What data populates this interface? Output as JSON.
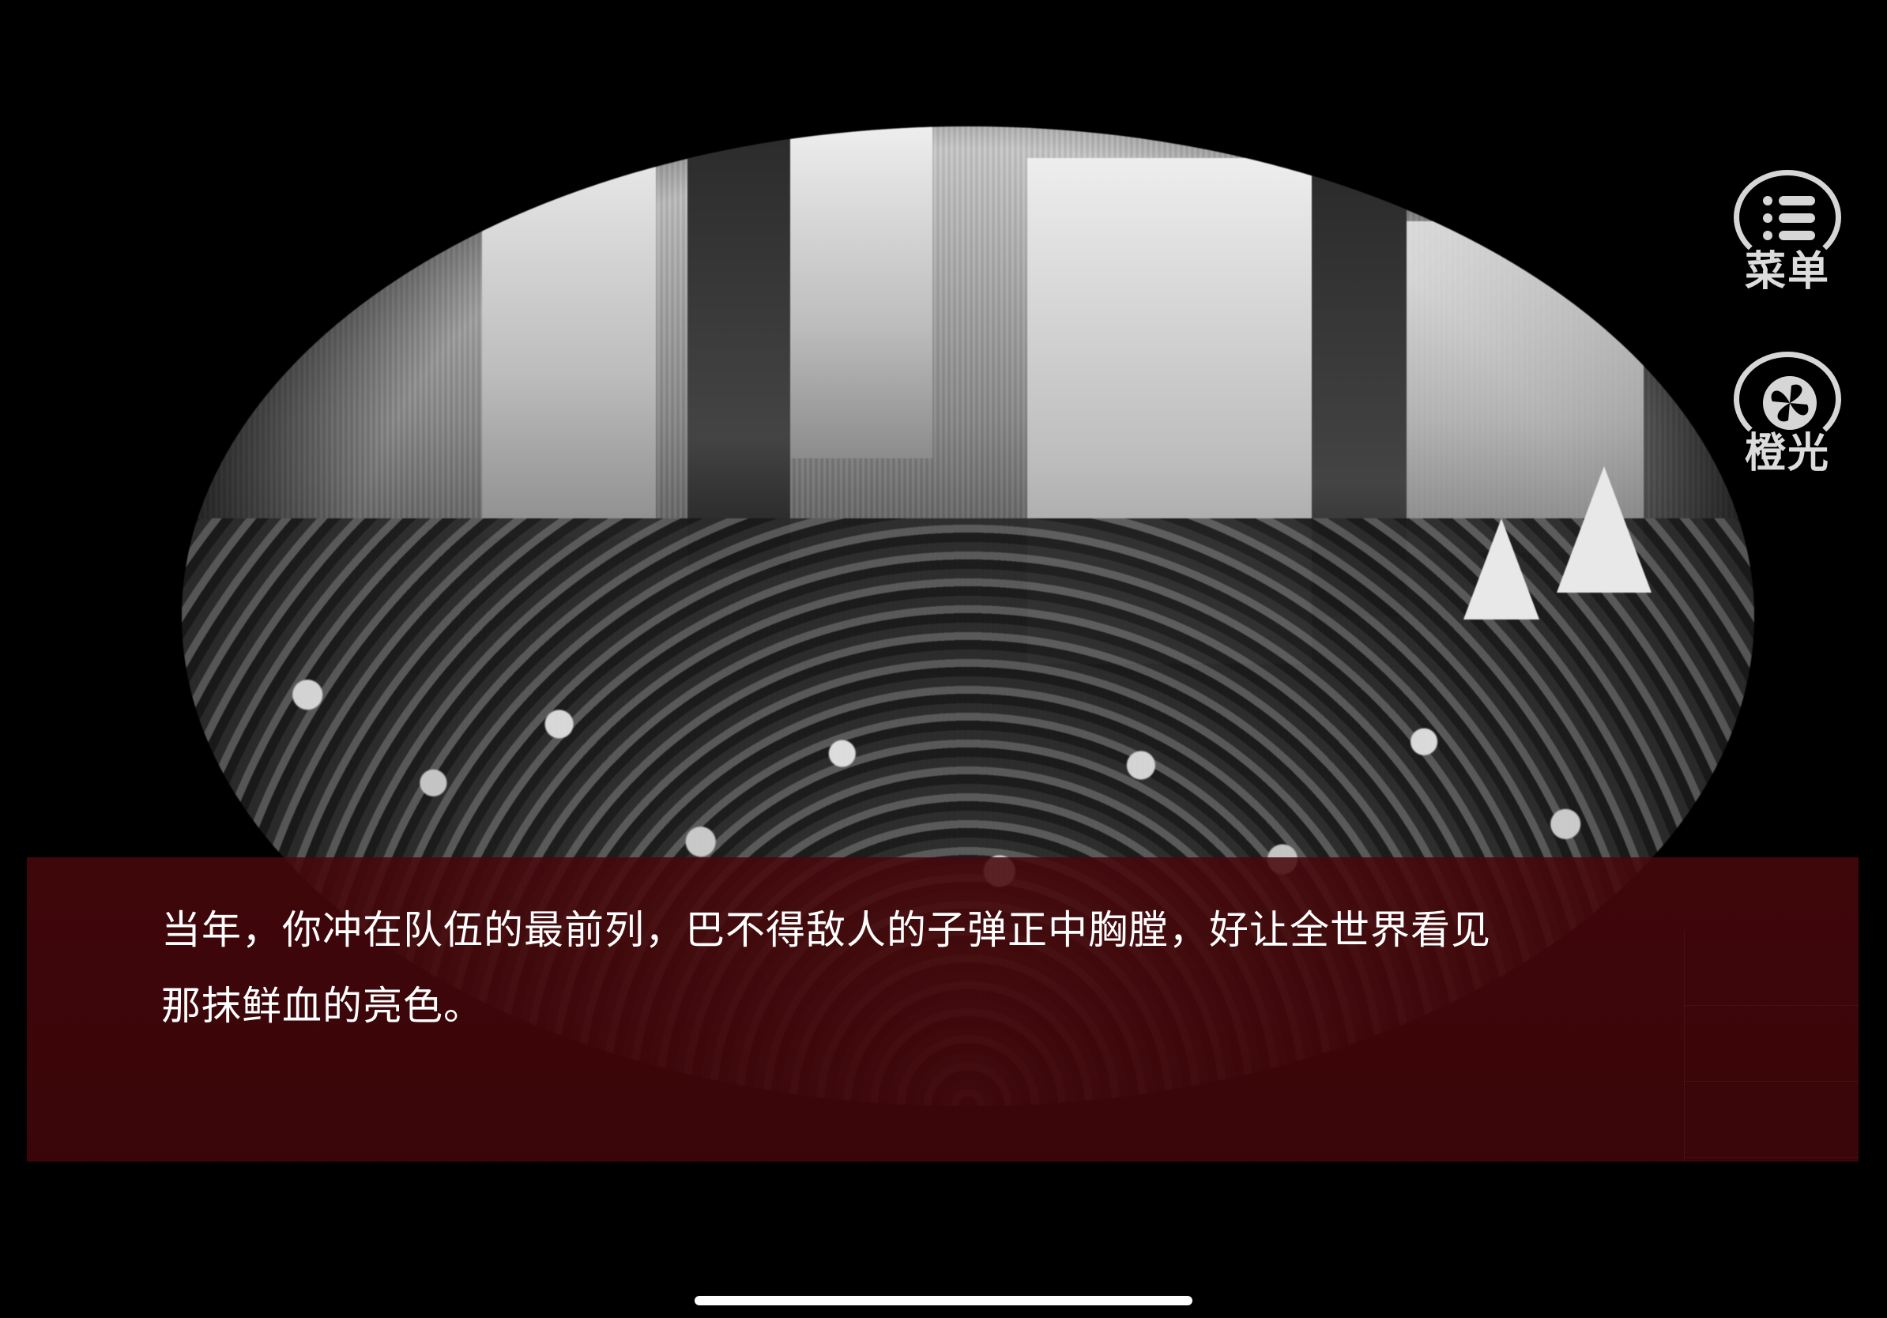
{
  "hud": {
    "menu": {
      "label": "菜单",
      "icon": "list-icon"
    },
    "orange_light": {
      "label": "橙光",
      "icon": "clover-icon"
    }
  },
  "dialogue": {
    "line1": "当年，你冲在队伍的最前列，巴不得敌人的子弹正中胸膛，好让全世界看见",
    "line2": "那抹鲜血的亮色。"
  },
  "colors": {
    "background": "#000000",
    "dialogue_box": "#480810",
    "hud_icon": "#d6d6d6",
    "dialogue_text": "#ffffff"
  }
}
